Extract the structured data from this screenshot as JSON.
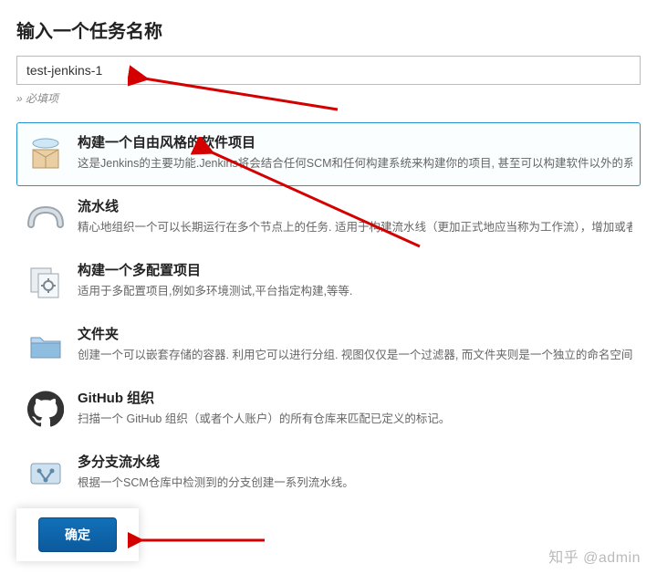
{
  "header": {
    "title": "输入一个任务名称"
  },
  "name_field": {
    "value": "test-jenkins-1",
    "placeholder": ""
  },
  "required_note": "» 必填项",
  "options": [
    {
      "key": "freestyle",
      "title": "构建一个自由风格的软件项目",
      "desc": "这是Jenkins的主要功能.Jenkins将会结合任何SCM和任何构建系统来构建你的项目, 甚至可以构建软件以外的系统.",
      "selected": true
    },
    {
      "key": "pipeline",
      "title": "流水线",
      "desc": "精心地组织一个可以长期运行在多个节点上的任务. 适用于构建流水线（更加正式地应当称为工作流），增加或者组织难以…",
      "selected": false
    },
    {
      "key": "multiconfig",
      "title": "构建一个多配置项目",
      "desc": "适用于多配置项目,例如多环境测试,平台指定构建,等等.",
      "selected": false
    },
    {
      "key": "folder",
      "title": "文件夹",
      "desc": "创建一个可以嵌套存储的容器. 利用它可以进行分组.  视图仅仅是一个过滤器, 而文件夹则是一个独立的命名空间，因此…",
      "selected": false
    },
    {
      "key": "github_org",
      "title": "GitHub 组织",
      "desc": "扫描一个 GitHub 组织（或者个人账户）的所有仓库来匹配已定义的标记。",
      "selected": false
    },
    {
      "key": "multibranch",
      "title": "多分支流水线",
      "desc": "根据一个SCM仓库中检测到的分支创建一系列流水线。",
      "selected": false
    }
  ],
  "footer": {
    "ok_label": "确定"
  },
  "watermark": "知乎 @admin"
}
